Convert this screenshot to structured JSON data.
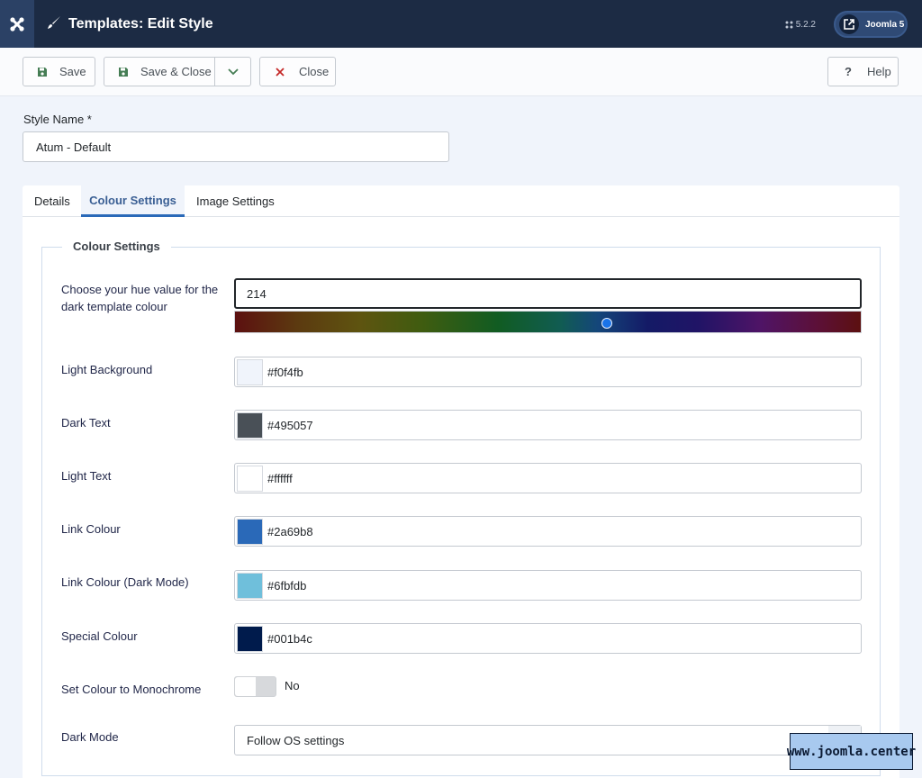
{
  "header": {
    "title": "Templates: Edit Style",
    "version": "5.2.2",
    "site_link_label": "Joomla 5"
  },
  "toolbar": {
    "save_label": "Save",
    "save_close_label": "Save & Close",
    "close_label": "Close",
    "help_label": "Help"
  },
  "form": {
    "style_name_label": "Style Name *",
    "style_name_value": "Atum - Default"
  },
  "tabs": [
    {
      "label": "Details",
      "active": false
    },
    {
      "label": "Colour Settings",
      "active": true
    },
    {
      "label": "Image Settings",
      "active": false
    }
  ],
  "colour_settings": {
    "legend": "Colour Settings",
    "hue_label": "Choose your hue value for the dark template colour",
    "hue_value": "214",
    "hue_fraction": 0.594,
    "fields": [
      {
        "label": "Light Background",
        "value": "#f0f4fb",
        "color": "#f0f4fb"
      },
      {
        "label": "Dark Text",
        "value": "#495057",
        "color": "#495057"
      },
      {
        "label": "Light Text",
        "value": "#ffffff",
        "color": "#ffffff"
      },
      {
        "label": "Link Colour",
        "value": "#2a69b8",
        "color": "#2a69b8"
      },
      {
        "label": "Link Colour (Dark Mode)",
        "value": "#6fbfdb",
        "color": "#6fbfdb"
      },
      {
        "label": "Special Colour",
        "value": "#001b4c",
        "color": "#001b4c"
      }
    ],
    "monochrome_label": "Set Colour to Monochrome",
    "monochrome_value": "No",
    "dark_mode_label": "Dark Mode",
    "dark_mode_value": "Follow OS settings"
  },
  "watermark": "www.joomla.center",
  "colors": {
    "header_bg": "#1c2b44",
    "accent": "#2a69b8",
    "page_bg": "#f0f4fb"
  }
}
